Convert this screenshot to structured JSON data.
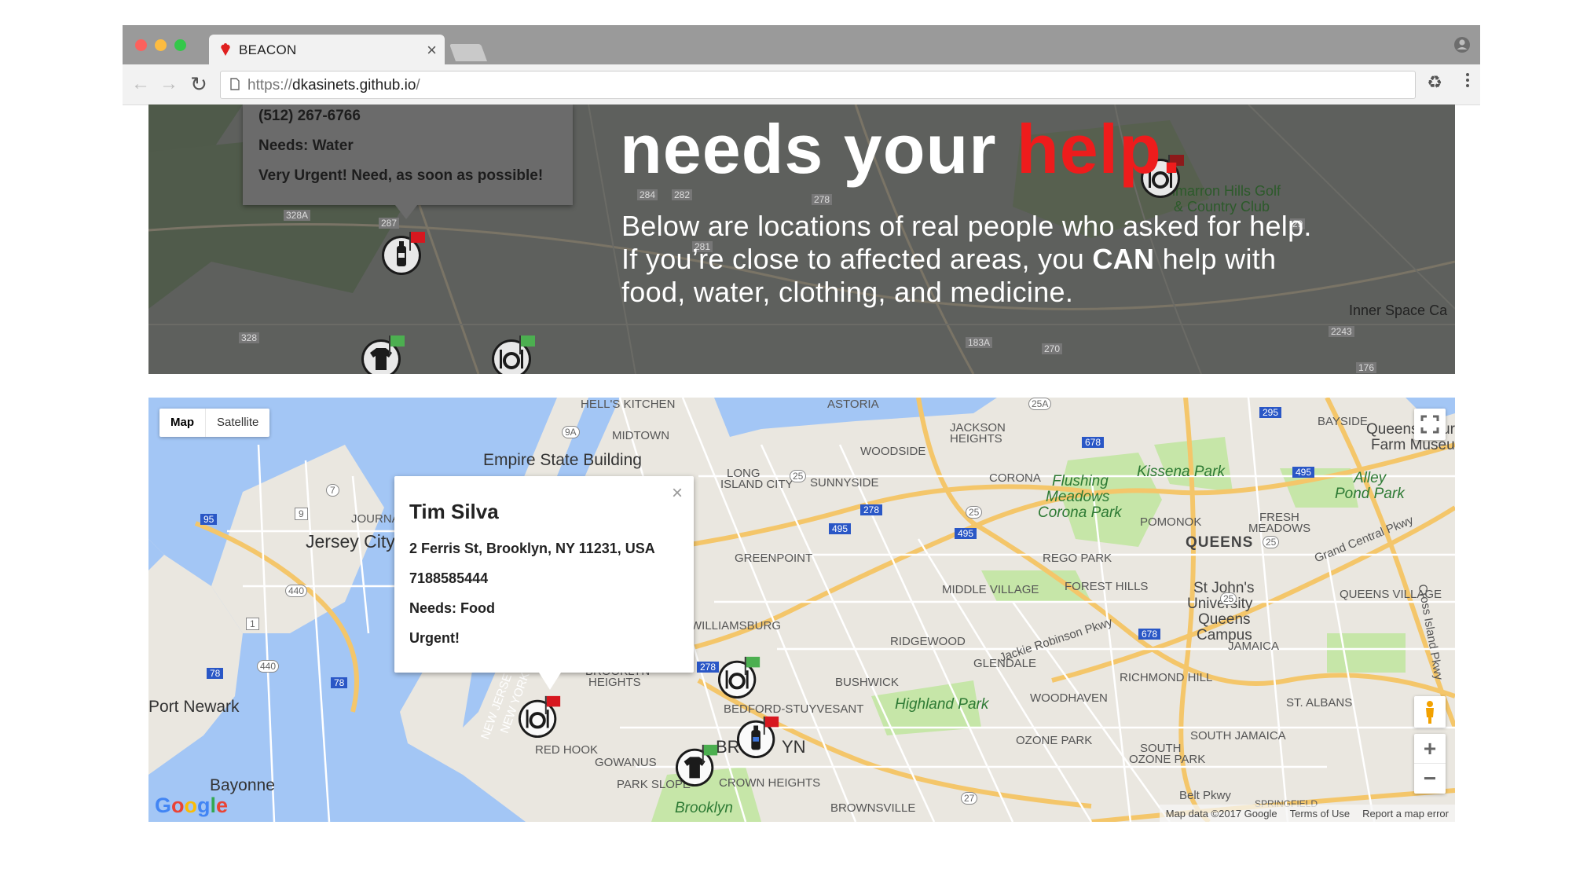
{
  "browser": {
    "tab_title": "BEACON",
    "url_prefix": "https://",
    "url_host": "dkasinets.github.io",
    "url_suffix": "/"
  },
  "hero": {
    "headline_white": "needs your ",
    "headline_red": "help.",
    "subtitle_line1": "Below are locations of real people who asked for help.",
    "subtitle_line2_pre": "If you’re close to affected areas, you ",
    "subtitle_line2_bold": "CAN",
    "subtitle_line2_post": " help with",
    "subtitle_line3": "food, water, clothing, and medicine.",
    "info": {
      "phone": "(512) 267-6766",
      "needs": "Needs: Water",
      "urgency": "Very Urgent! Need, as soon as possible!"
    },
    "map_labels": {
      "golf": "Cimarron Hills Golf",
      "golf2": "& Country Club",
      "inner_space": "Inner Space Ca",
      "r328a": "328A",
      "r287": "287",
      "r328": "328",
      "r284": "284",
      "r282": "282",
      "r278": "278",
      "r281": "281",
      "r29": "29",
      "r183a": "183A",
      "r270": "270",
      "r2243": "2243",
      "r176": "176"
    }
  },
  "map": {
    "map_button": "Map",
    "satellite_button": "Satellite",
    "info": {
      "name": "Tim Silva",
      "address": "2 Ferris St, Brooklyn, NY 11231, USA",
      "phone": "7188585444",
      "needs": "Needs: Food",
      "urgency": "Urgent!"
    },
    "footer": {
      "data": "Map data ©2017 Google",
      "terms": "Terms of Use",
      "report": "Report a map error"
    },
    "labels": {
      "empire": "Empire State Building",
      "jersey_city": "Jersey City",
      "port_newark": "Port Newark",
      "bayonne": "Bayonne",
      "queens": "QUEENS",
      "kissena": "Kissena Park",
      "flushing": "Flushing",
      "flushing2": "Meadows",
      "flushing3": "Corona Park",
      "alley": "Alley",
      "alley2": "Pond Park",
      "stjohns": "St John's",
      "stjohns2": "University",
      "stjohns3": "Queens",
      "stjohns4": "Campus",
      "highland": "Highland Park",
      "brooklyn": "Brooklyn",
      "queens_farm": "Queens Cour",
      "queens_farm2": "Farm Museu",
      "midtown": "MIDTOWN",
      "woodside": "WOODSIDE",
      "jackson": "JACKSON",
      "jackson2": "HEIGHTS",
      "corona": "CORONA",
      "sunnyside": "SUNNYSIDE",
      "lic": "LONG",
      "lic2": "ISLAND CITY",
      "greenpoint": "GREENPOINT",
      "williamsburg": "WILLIAMSBURG",
      "ridgewood": "RIDGEWOOD",
      "glendale": "GLENDALE",
      "middle_village": "MIDDLE VILLAGE",
      "forest_hills": "FOREST HILLS",
      "rego_park": "REGO PARK",
      "richmond_hill": "RICHMOND HILL",
      "woodhaven": "WOODHAVEN",
      "bushwick": "BUSHWICK",
      "bed_stuy": "BEDFORD-STUYVESANT",
      "brooklyn_heights": "BROOKLYN",
      "brooklyn_heights2": "HEIGHTS",
      "red_hook": "RED HOOK",
      "gowanus": "GOWANUS",
      "park_slope": "PARK SLOPE",
      "crown_heights": "CROWN HEIGHTS",
      "brownsville": "BROWNSVILLE",
      "ozone_park": "OZONE PARK",
      "south_ozone": "SOUTH",
      "south_ozone2": "OZONE PARK",
      "south_jamaica": "SOUTH JAMAICA",
      "jamaica": "JAMAICA",
      "st_albans": "ST. ALBANS",
      "pomonok": "POMONOK",
      "fresh_meadows": "FRESH",
      "fresh_meadows2": "MEADOWS",
      "bayside": "BAYSIDE",
      "queens_village": "QUEENS VILLAGE",
      "journal": "JOURNAL",
      "hells_kitchen": "HELL'S KITCHEN",
      "astoria": "ASTORIA",
      "brooklyn_partial": "BR",
      "brooklyn_partial2": "YN",
      "jackie_robinson": "Jackie Robinson Pkwy",
      "grand_central": "Grand Central Pkwy",
      "belt_pkwy": "Belt Pkwy",
      "springfield": "SPRINGFIELD",
      "cross_island": "Cross Island Pkwy",
      "new_jersey": "NEW JERSEY",
      "new_york": "NEW YORK",
      "i95": "95",
      "i495a": "495",
      "i495b": "495",
      "i495c": "495",
      "i278a": "278",
      "i278b": "278",
      "i678a": "678",
      "i678b": "678",
      "i295": "295",
      "i78a": "78",
      "i78b": "78",
      "r440a": "440",
      "r440b": "440",
      "r9": "9",
      "r7": "7",
      "r25a": "25",
      "r25b": "25",
      "r25c": "25",
      "r25d": "25",
      "r25A": "25A",
      "r9a": "9A",
      "r27": "27",
      "r1": "1"
    }
  },
  "colors": {
    "headline_red": "#ee1c1c",
    "water": "#a3c6f5",
    "park": "#c6e6a8",
    "highway": "#f4c66a",
    "flag_red": "#d7171f",
    "flag_green": "#4caf50"
  },
  "icons": {
    "tab_favicon": "heart-pin-icon",
    "pin_food": "plate-fork-knife-icon",
    "pin_water": "water-bottle-icon",
    "pin_clothing": "shirt-icon"
  }
}
